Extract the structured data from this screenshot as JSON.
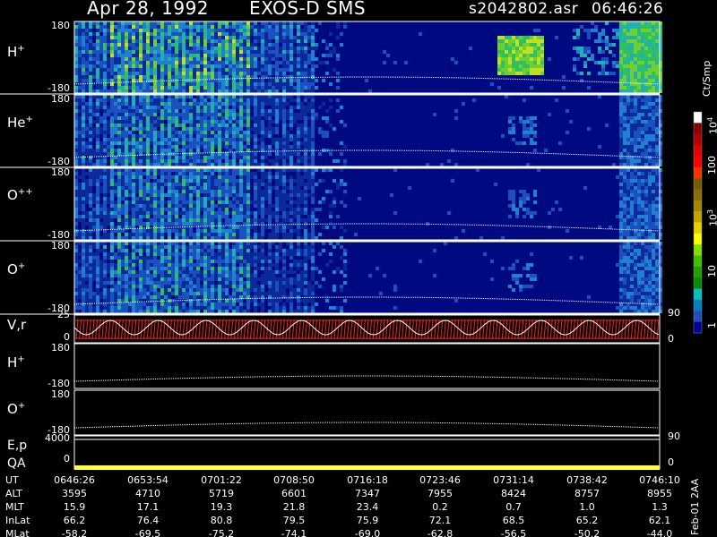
{
  "header": {
    "date": "Apr 28, 1992",
    "instrument": "EXOS-D SMS",
    "file": "s2042802.asr",
    "time": "06:46:26"
  },
  "panels": [
    {
      "label": "H",
      "sup": "+",
      "ymax": "180",
      "ymin": "-180"
    },
    {
      "label": "He",
      "sup": "+",
      "ymax": "180",
      "ymin": "-180"
    },
    {
      "label": "O",
      "sup": "++",
      "ymax": "180",
      "ymin": "-180"
    },
    {
      "label": "O",
      "sup": "+",
      "ymax": "180",
      "ymin": "-180"
    }
  ],
  "vr_panel": {
    "label": "V,r",
    "ytop": "25",
    "ybottom": "0",
    "rtop": "90",
    "rbottom": "0"
  },
  "line_panels": [
    {
      "label": "H",
      "sup": "+",
      "ymax": "180",
      "ymin": "-180"
    },
    {
      "label": "O",
      "sup": "+",
      "ymax": "180",
      "ymin": "-180"
    }
  ],
  "ep_panel": {
    "label1": "E,p",
    "label2": "QA",
    "ytop": "4000",
    "ybottom": "0",
    "rtop": "90",
    "rbottom": "0"
  },
  "colorbar": {
    "unit": "Ct/Smp",
    "labels": [
      "10",
      "100",
      "10",
      "10",
      "1"
    ],
    "exponents": [
      "4",
      "",
      "3",
      "",
      ""
    ],
    "colors": [
      "#ffffff",
      "#8b0000",
      "#b00000",
      "#e00000",
      "#ff0000",
      "#ff3000",
      "#7a5a00",
      "#8a7000",
      "#a08800",
      "#c0a800",
      "#e8d000",
      "#ffff00",
      "#80e000",
      "#40c000",
      "#20a000",
      "#009000",
      "#00c0c0",
      "#0080c0",
      "#2050c0",
      "#0000a0"
    ]
  },
  "side_note": "Feb-01  2AA",
  "chart_data": {
    "type": "table",
    "row_labels": [
      "UT",
      "ALT",
      "MLT",
      "InLat",
      "MLat"
    ],
    "columns": [
      [
        "0646:26",
        "3595",
        "15.9",
        "66.2",
        "-58.2"
      ],
      [
        "0653:54",
        "4710",
        "17.1",
        "76.4",
        "-69.5"
      ],
      [
        "0701:22",
        "5719",
        "19.3",
        "80.8",
        "-75.2"
      ],
      [
        "0708:50",
        "6601",
        "21.8",
        "79.5",
        "-74.1"
      ],
      [
        "0716:18",
        "7347",
        "23.4",
        "75.9",
        "-69.0"
      ],
      [
        "0723:46",
        "7955",
        "0.2",
        "72.1",
        "-62.8"
      ],
      [
        "0731:14",
        "8424",
        "0.7",
        "68.5",
        "-56.5"
      ],
      [
        "0738:42",
        "8757",
        "1.0",
        "65.2",
        "-50.2"
      ],
      [
        "0746:10",
        "8955",
        "1.3",
        "62.1",
        "-44.0"
      ]
    ]
  }
}
